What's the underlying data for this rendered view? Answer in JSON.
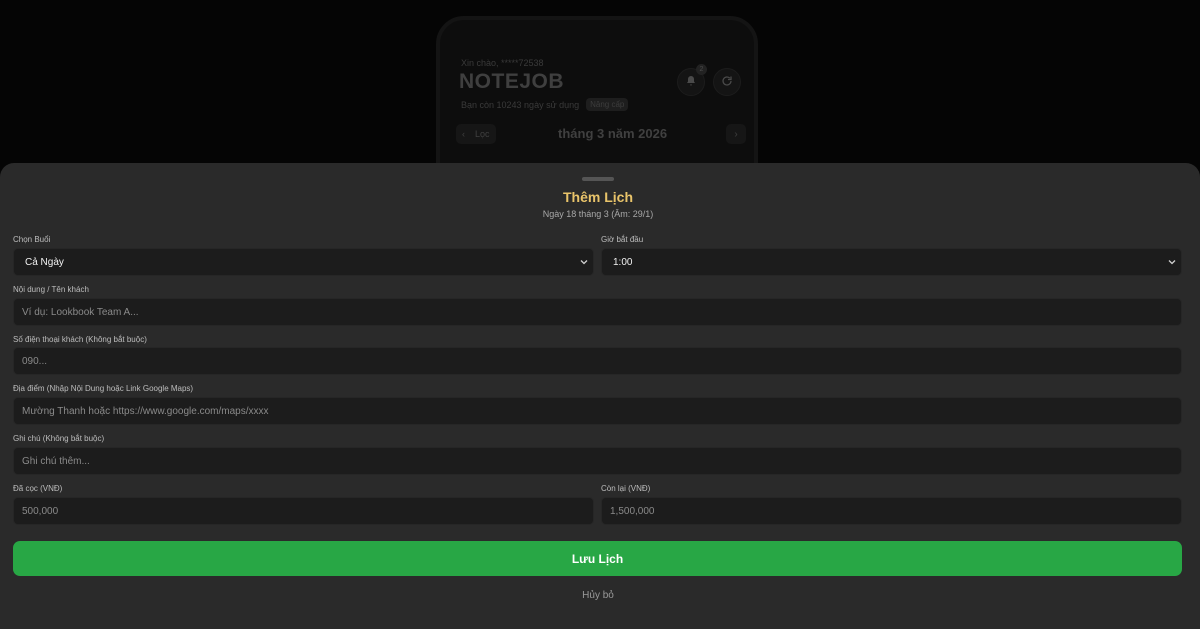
{
  "background_app": {
    "greeting": "Xin chào, *****72538",
    "title": "NOTEJOB",
    "days_left": "Bạn còn 10243 ngày sử dụng",
    "upgrade_label": "Nâng cấp",
    "notification_count": "2",
    "filter_label": "Lọc",
    "month_label": "tháng 3 năm 2026",
    "icons": [
      "bell-icon",
      "refresh-icon",
      "chevron-left-icon",
      "chevron-right-icon"
    ]
  },
  "modal": {
    "title": "Thêm Lịch",
    "subtitle": "Ngày 18 tháng 3 (Âm: 29/1)",
    "session": {
      "label": "Chọn Buổi",
      "value": "Cả Ngày"
    },
    "start_time": {
      "label": "Giờ bắt đầu",
      "value": "1:00"
    },
    "content": {
      "label": "Nội dung / Tên khách",
      "placeholder": "Ví dụ: Lookbook Team A..."
    },
    "phone": {
      "label": "Số điện thoại khách (Không bắt buộc)",
      "placeholder": "090..."
    },
    "location": {
      "label": "Địa điểm (Nhập Nội Dung hoặc Link Google Maps)",
      "placeholder": "Mường Thanh hoặc https://www.google.com/maps/xxxx"
    },
    "note": {
      "label": "Ghi chú (Không bắt buộc)",
      "placeholder": "Ghi chú thêm..."
    },
    "deposit": {
      "label": "Đã cọc (VNĐ)",
      "value": "500,000"
    },
    "remaining": {
      "label": "Còn lại (VNĐ)",
      "value": "1,500,000"
    },
    "save_label": "Lưu Lịch",
    "cancel_label": "Hủy bỏ",
    "accent_color": "#e9c46a",
    "save_color": "#28a745"
  }
}
